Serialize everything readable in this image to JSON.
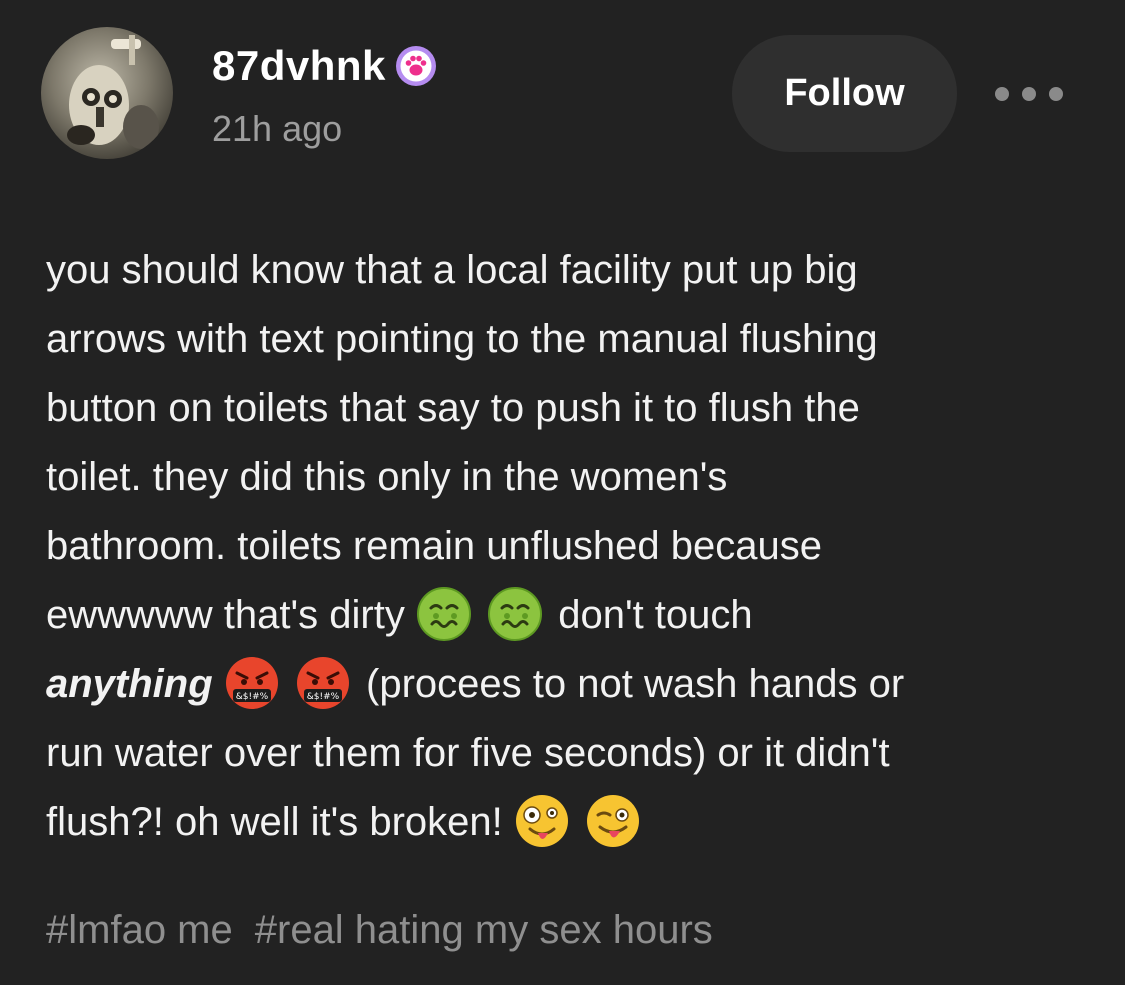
{
  "post": {
    "author": {
      "username": "87dvhnk",
      "badge_icon": "paw-icon",
      "timestamp": "21h ago"
    },
    "actions": {
      "follow_label": "Follow",
      "more_icon": "more-icon"
    },
    "body": {
      "line1": "you should know that a local facility put up big",
      "line2": "arrows with text pointing to the manual flushing",
      "line3": "button on toilets that say to push it to flush the",
      "line4": "toilet. they did this only in the women's",
      "line5": "bathroom. toilets remain unflushed because",
      "line6_pre": "ewwwww that's dirty",
      "line6_post": "don't touch",
      "line7_emphasis": "anything",
      "line7_post": "(procees to not wash hands or",
      "line8": "run water over them for five seconds) or it didn't",
      "line9_pre": "flush?! oh well it's broken!",
      "emojis": [
        "nauseated-face-emoji",
        "nauseated-face-emoji",
        "cursing-face-emoji",
        "cursing-face-emoji",
        "zany-face-emoji",
        "winking-tongue-emoji"
      ]
    },
    "tags": [
      "#lmfao me",
      "#real hating my sex hours"
    ]
  },
  "colors": {
    "background": "#222222",
    "text": "#f2f2f2",
    "muted": "#9e9e9e",
    "button_bg": "#2f2f2f"
  }
}
